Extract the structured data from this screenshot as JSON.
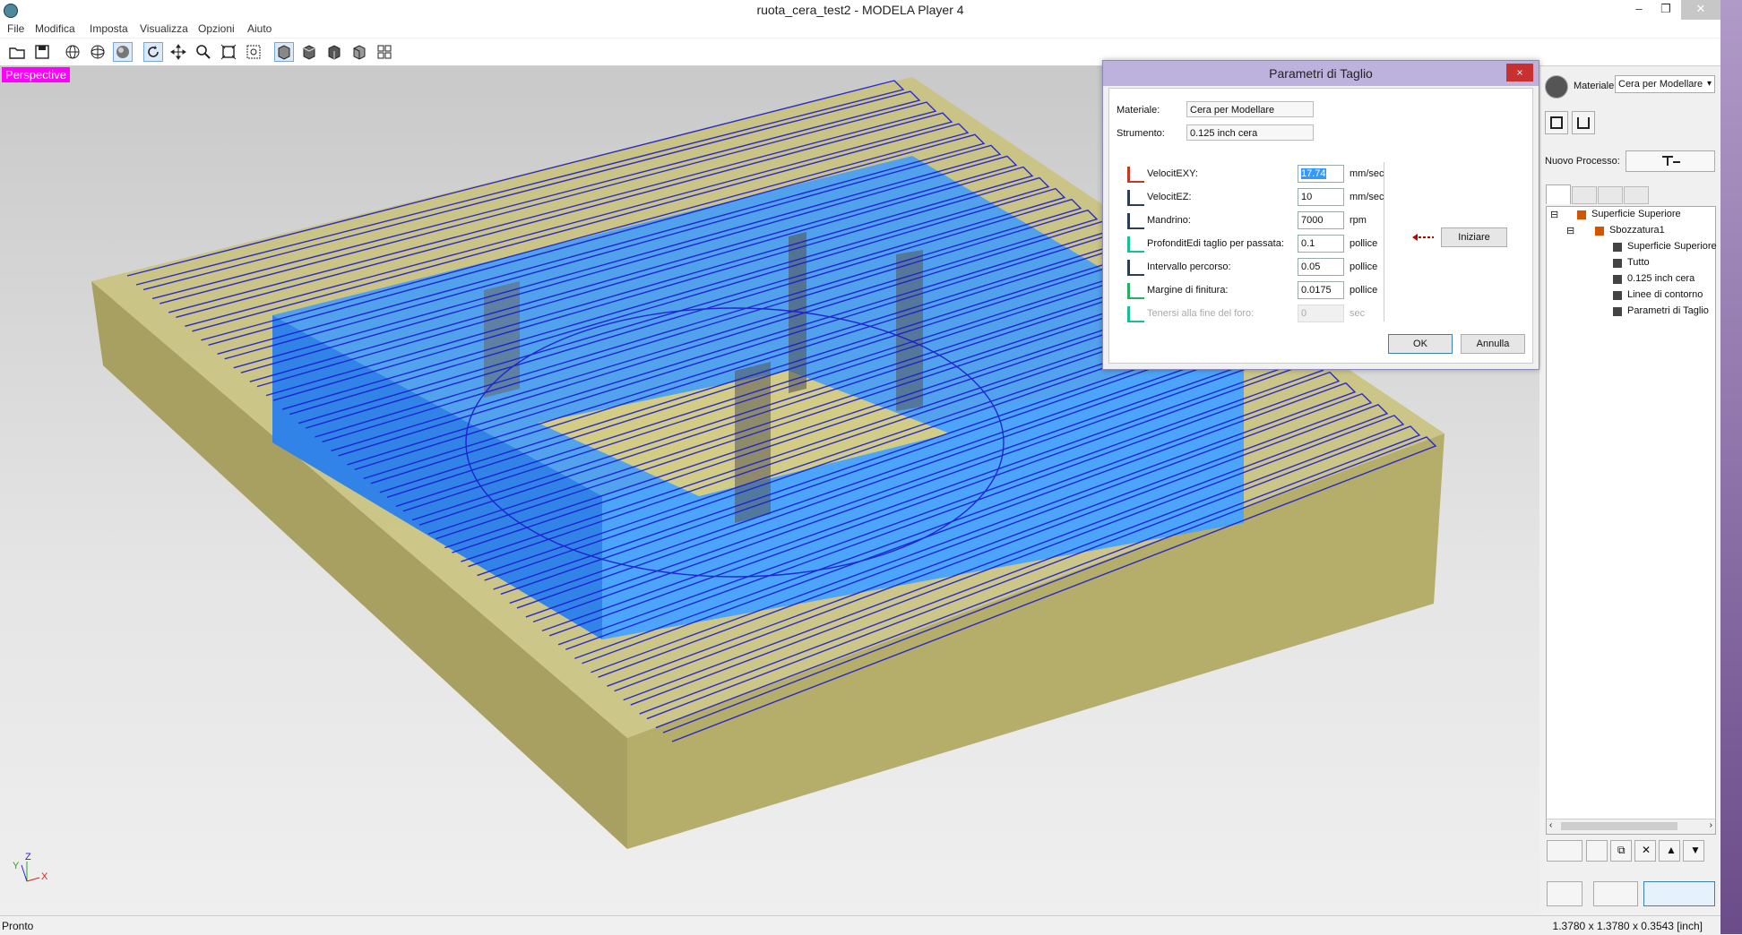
{
  "window": {
    "title": "ruota_cera_test2 - MODELA Player 4"
  },
  "menu": [
    "File",
    "Modifica",
    "Imposta",
    "Visualizza",
    "Opzioni",
    "Aiuto"
  ],
  "toolbar_icons": [
    "open-folder-icon",
    "save-icon",
    "wireframe-globe-icon",
    "globe-icon",
    "sphere-shaded-icon",
    "rotate-icon",
    "pan-icon",
    "zoom-icon",
    "fit-all-icon",
    "zoom-window-icon",
    "view-front-icon",
    "view-top-icon",
    "view-right-icon",
    "view-iso-icon",
    "view-multi-icon"
  ],
  "viewport": {
    "label": "Perspective",
    "axes": {
      "y": "Y",
      "z": "Z",
      "x": "X"
    }
  },
  "dialog": {
    "title": "Parametri di Taglio",
    "close": "×",
    "material_label": "Materiale:",
    "material_value": "Cera per Modellare",
    "tool_label": "Strumento:",
    "tool_value": "0.125 inch cera",
    "params": [
      {
        "label": "VelocitEXY:",
        "value": "17.74",
        "unit": "mm/sec",
        "selected": true,
        "disabled": false
      },
      {
        "label": "VelocitEZ:",
        "value": "10",
        "unit": "mm/sec",
        "disabled": false
      },
      {
        "label": "Mandrino:",
        "value": "7000",
        "unit": "rpm",
        "disabled": false
      },
      {
        "label": "ProfonditEdi taglio per passata:",
        "value": "0.1",
        "unit": "pollice",
        "disabled": false
      },
      {
        "label": "Intervallo percorso:",
        "value": "0.05",
        "unit": "pollice",
        "disabled": false
      },
      {
        "label": "Margine di finitura:",
        "value": "0.0175",
        "unit": "pollice",
        "disabled": false
      },
      {
        "label": "Tenersi alla fine del foro:",
        "value": "0",
        "unit": "sec",
        "disabled": true
      }
    ],
    "start_label": "Iniziare",
    "ok_label": "OK",
    "cancel_label": "Annulla"
  },
  "right_panel": {
    "material_label": "Materiale",
    "material_value": "Cera per Modellare",
    "new_process_label": "Nuovo Processo:",
    "tree": [
      {
        "label": "Superficie Superiore",
        "level": 0
      },
      {
        "label": "Sbozzatura1",
        "level": 1
      },
      {
        "label": "Superficie Superiore",
        "level": 2
      },
      {
        "label": "Tutto",
        "level": 2
      },
      {
        "label": "0.125 inch cera",
        "level": 2
      },
      {
        "label": "Linee di contorno",
        "level": 2
      },
      {
        "label": "Parametri di Taglio",
        "level": 2
      }
    ]
  },
  "status": {
    "left": "Pronto",
    "right": "1.3780 x 1.3780 x 0.3543 [inch]"
  }
}
